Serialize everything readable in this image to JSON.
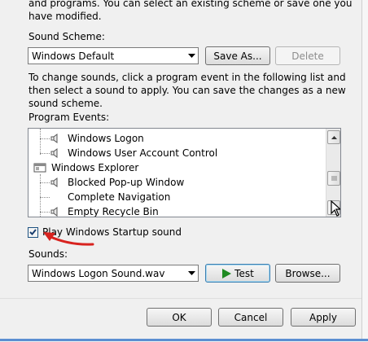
{
  "intro": {
    "line1": "and programs.  You can select an existing scheme or save one you",
    "line2": "have modified."
  },
  "scheme": {
    "label": "Sound Scheme:",
    "selected": "Windows Default",
    "save_as_label": "Save As...",
    "delete_label": "Delete"
  },
  "instructions": {
    "line1": "To change sounds, click a program event in the following list and",
    "line2": "then select a sound to apply.  You can save the changes as a new",
    "line3": "sound scheme."
  },
  "events": {
    "label": "Program Events:",
    "items": [
      {
        "label": "Windows Logon",
        "type": "event",
        "has_sound": true
      },
      {
        "label": "Windows User Account Control",
        "type": "event",
        "has_sound": true
      },
      {
        "label": "Windows Explorer",
        "type": "group"
      },
      {
        "label": "Blocked Pop-up Window",
        "type": "event",
        "has_sound": true
      },
      {
        "label": "Complete Navigation",
        "type": "event",
        "has_sound": false
      },
      {
        "label": "Empty Recycle Bin",
        "type": "event",
        "has_sound": true
      }
    ]
  },
  "startup": {
    "label": "Play Windows Startup sound",
    "checked": true
  },
  "sounds": {
    "label": "Sounds:",
    "selected": "Windows Logon Sound.wav",
    "test_label": "Test",
    "browse_label": "Browse..."
  },
  "footer": {
    "ok_label": "OK",
    "cancel_label": "Cancel",
    "apply_label": "Apply"
  },
  "colors": {
    "annotation_arrow": "#d8231f",
    "test_triangle": "#1f8a22",
    "checkbox_mark": "#1a3e6e"
  }
}
